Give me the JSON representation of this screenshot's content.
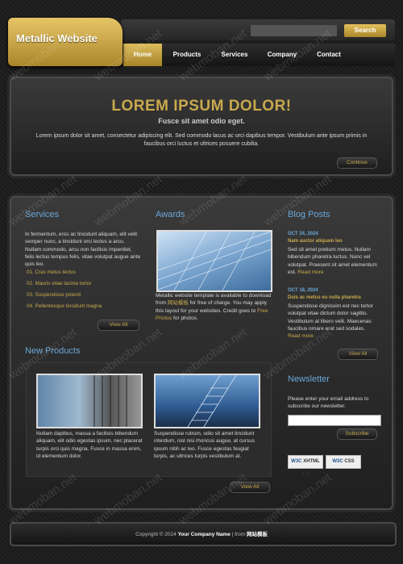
{
  "header": {
    "logo_text": "Metallic Website",
    "search": {
      "placeholder": "",
      "button_label": "Search"
    },
    "nav": [
      {
        "label": "Home",
        "active": true
      },
      {
        "label": "Products"
      },
      {
        "label": "Services"
      },
      {
        "label": "Company"
      },
      {
        "label": "Contact"
      }
    ]
  },
  "hero": {
    "title": "LOREM IPSUM DOLOR!",
    "subtitle": "Fusce sit amet odio eget.",
    "text": "Lorem ipsum dolor sit amet, consectetur adipiscing elit. Sed commodo lacus ac orci dapibus tempor. Vestibulum ante ipsum primis in faucibus orci luctus et ultrices posuere cubilia.",
    "button": "Continue"
  },
  "services": {
    "title": "Services",
    "text": "In fermentum, eros ac tincidunt aliquam, elit velit semper nunc, a tincidunt orci lectus a arcu. Nullam commodo, arcu non facilisis imperdiet, felis lectus tempus felis, vitae volutpat augue ante quis leo.",
    "items": [
      {
        "num": "01.",
        "label": "Cras metus lectus"
      },
      {
        "num": "02.",
        "label": "Mauris vitae lacinia tortor"
      },
      {
        "num": "03.",
        "label": "Suspendisse potenti"
      },
      {
        "num": "04.",
        "label": "Pellentesque tincidunt magna"
      }
    ],
    "button": "View All"
  },
  "awards": {
    "title": "Awards",
    "text_a": "Metallic website template is available to download from ",
    "link1": "网站模板",
    "text_b": " for free of charge. You may apply this layout for your websites. Credit goes to ",
    "link2": "Free Photos",
    "text_c": " for photos."
  },
  "blog": {
    "title": "Blog Posts",
    "posts": [
      {
        "date": "OCT 24, 2024",
        "title": "Nam auctor aliquam leo",
        "text": "Sed sit amet pretium metus. Nullam bibendum pharetra luctus. Nunc vel volutpat. Praesent sit amet elementum est.",
        "more": "Read more"
      },
      {
        "date": "OCT 18, 2024",
        "title": "Duis ac metus eu nulla pharetra",
        "text": "Suspendisse dignissim est nec tortor volutpat vitae dictum dolor sagittis. Vestibulum at libero velit. Maecenas faucibus ornare erat sed sodales.",
        "more": "Read more"
      }
    ],
    "button": "View All"
  },
  "products": {
    "title": "New Products",
    "items": [
      {
        "text": "Nullam dapibus, massa a facilisis bibendum aliquam, elit odio egestas ipsum, nec placerat turpis orci quis magna. Fusce in massa enim, id elementum dolor."
      },
      {
        "text": "Suspendisse rutrum, odio sit amet tincidunt interdum, nisl nisi rhoncus augue, at cursus ipsum nibh ac leo. Fusce egestas feugiat turpis, ac ultrices turpis vestibulum at."
      }
    ],
    "button": "View All"
  },
  "newsletter": {
    "title": "Newsletter",
    "text": "Please enter your email address to subscribe our newsletter.",
    "button": "Subscribe",
    "badges": [
      {
        "a": "W3C",
        "b": "XHTML 1.0"
      },
      {
        "a": "W3C",
        "b": "CSS"
      }
    ]
  },
  "footer": {
    "prefix": "Copyright © 2024 ",
    "company": "Your Company Name",
    "mid": " | from ",
    "link": "网站模板"
  },
  "watermark": "webmoban.net",
  "colors": {
    "gold": "#c9a94d",
    "blue": "#6aa7d8",
    "bg": "#1c1c1c"
  }
}
